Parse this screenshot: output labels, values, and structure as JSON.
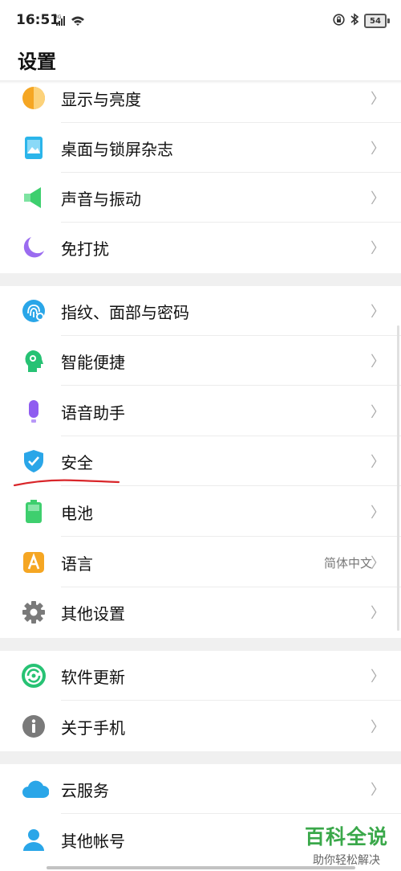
{
  "status_bar": {
    "time": "16:51",
    "network": "3G",
    "battery": "54"
  },
  "page_title": "设置",
  "chevron": "〉",
  "items": [
    {
      "label": "显示与亮度",
      "icon": "display-brightness-icon",
      "color": "#f5a623"
    },
    {
      "label": "桌面与锁屏杂志",
      "icon": "wallpaper-icon",
      "color": "#2bb5ea"
    },
    {
      "label": "声音与振动",
      "icon": "sound-icon",
      "color": "#3ecf6e"
    },
    {
      "label": "免打扰",
      "icon": "moon-icon",
      "color": "#9b6cf0"
    },
    {
      "label": "指纹、面部与密码",
      "icon": "fingerprint-icon",
      "color": "#2aa6e8"
    },
    {
      "label": "智能便捷",
      "icon": "smart-assist-icon",
      "color": "#27c274"
    },
    {
      "label": "语音助手",
      "icon": "microphone-icon",
      "color": "#8f5cf0"
    },
    {
      "label": "安全",
      "icon": "shield-icon",
      "color": "#2aa6e8"
    },
    {
      "label": "电池",
      "icon": "battery-icon",
      "color": "#3ecf6e"
    },
    {
      "label": "语言",
      "value": "简体中文",
      "icon": "language-icon",
      "color": "#f5a623"
    },
    {
      "label": "其他设置",
      "icon": "gear-icon",
      "color": "#7a7a7a"
    },
    {
      "label": "软件更新",
      "icon": "update-icon",
      "color": "#27c274"
    },
    {
      "label": "关于手机",
      "icon": "info-icon",
      "color": "#7a7a7a"
    },
    {
      "label": "云服务",
      "icon": "cloud-icon",
      "color": "#2aa6e8"
    },
    {
      "label": "其他帐号",
      "icon": "account-icon",
      "color": "#2aa6e8"
    }
  ],
  "watermark": {
    "title": "百科全说",
    "subtitle": "助你轻松解决"
  }
}
